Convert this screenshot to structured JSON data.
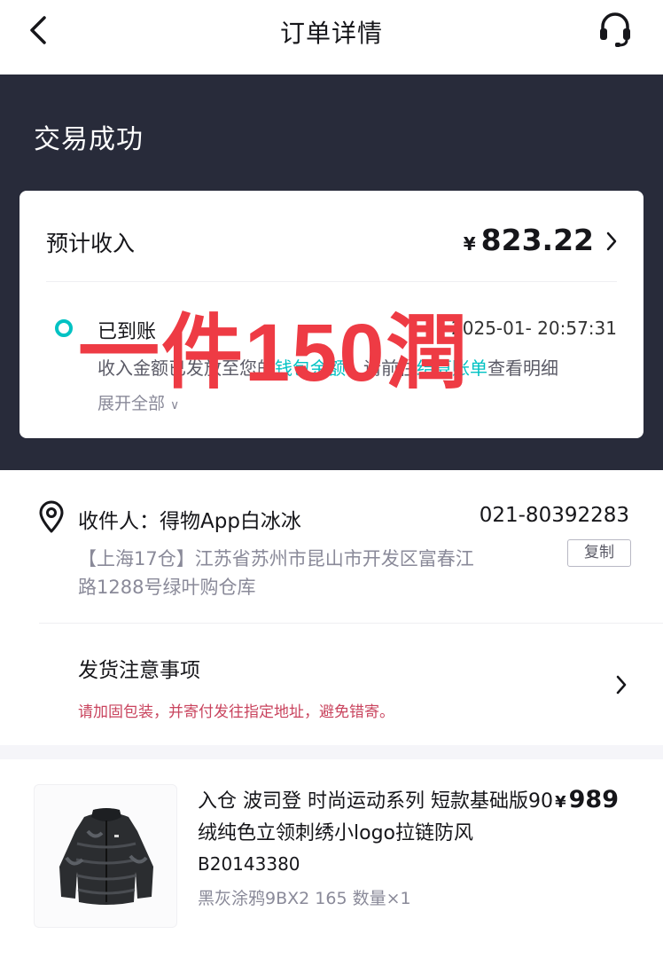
{
  "nav": {
    "title": "订单详情",
    "back_icon": "chevron-left-icon",
    "service_icon": "headset-icon"
  },
  "status": {
    "title": "交易成功"
  },
  "income": {
    "label": "预计收入",
    "currency": "¥",
    "amount": "823.22",
    "timeline": {
      "title": "已到账",
      "time": "2025-01-  20:57:31",
      "desc_prefix": "收入金额已发放至您的",
      "desc_link1": "钱包余额",
      "desc_mid": "，请前往",
      "desc_link2": "结算账单",
      "desc_suffix": "查看明细",
      "expand_label": "展开全部"
    }
  },
  "watermark": {
    "text": "一件150潤"
  },
  "address": {
    "recipient": "收件人：得物App白冰冰",
    "phone": "021-80392283",
    "line1": "【上海17仓】江苏省苏州市昆山市开发区富春江",
    "line2": "路1288号绿叶购仓库",
    "copy_label": "复制"
  },
  "shipping": {
    "title": "发货注意事项",
    "note": "请加固包装，并寄付发往指定地址，避免错寄。"
  },
  "product": {
    "name": "入仓 波司登 时尚运动系列 短款基础版90绒纯色立领刺绣小logo拉链防风",
    "currency": "¥",
    "price": "989",
    "sku": "B20143380",
    "spec": "黑灰涂鸦9BX2 165 数量×1"
  },
  "colors": {
    "header_bg": "#282b3a",
    "accent": "#01c2c3",
    "warning_text": "#c9445e",
    "watermark": "#ee3b44"
  }
}
